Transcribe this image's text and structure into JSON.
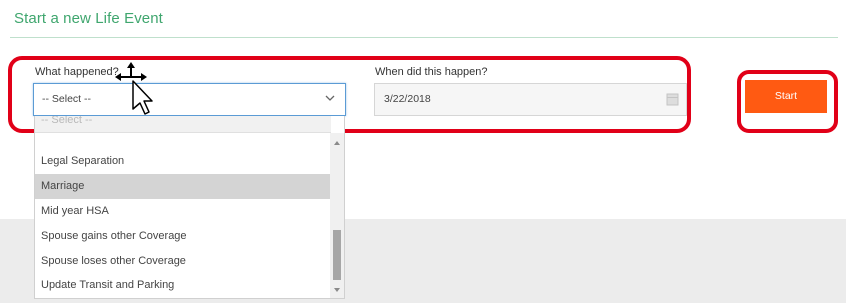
{
  "page": {
    "title": "Start a new Life Event"
  },
  "form": {
    "what_label": "What happened?",
    "what_value": "-- Select --",
    "when_label": "When did this happen?",
    "when_value": "3/22/2018",
    "start_label": "Start"
  },
  "dropdown": {
    "partial_option": "-- Select --",
    "options": [
      {
        "label": "Legal Separation"
      },
      {
        "label": "Marriage",
        "highlighted": true
      },
      {
        "label": "Mid year HSA"
      },
      {
        "label": "Spouse gains other Coverage"
      },
      {
        "label": "Spouse loses other Coverage"
      },
      {
        "label": "Update Transit and Parking"
      }
    ]
  },
  "icons": {
    "select_caret": "chevron-down-icon",
    "date_picker": "calendar-icon",
    "mouse_cursor": "cursor-arrow-icon",
    "move_cursor": "cursor-move-icon"
  },
  "colors": {
    "title": "#3fa66e",
    "start_button": "#ff5a12",
    "annotation": "#e10018",
    "focus_border": "#5b9bd5",
    "highlight": "#d4d4d4"
  }
}
